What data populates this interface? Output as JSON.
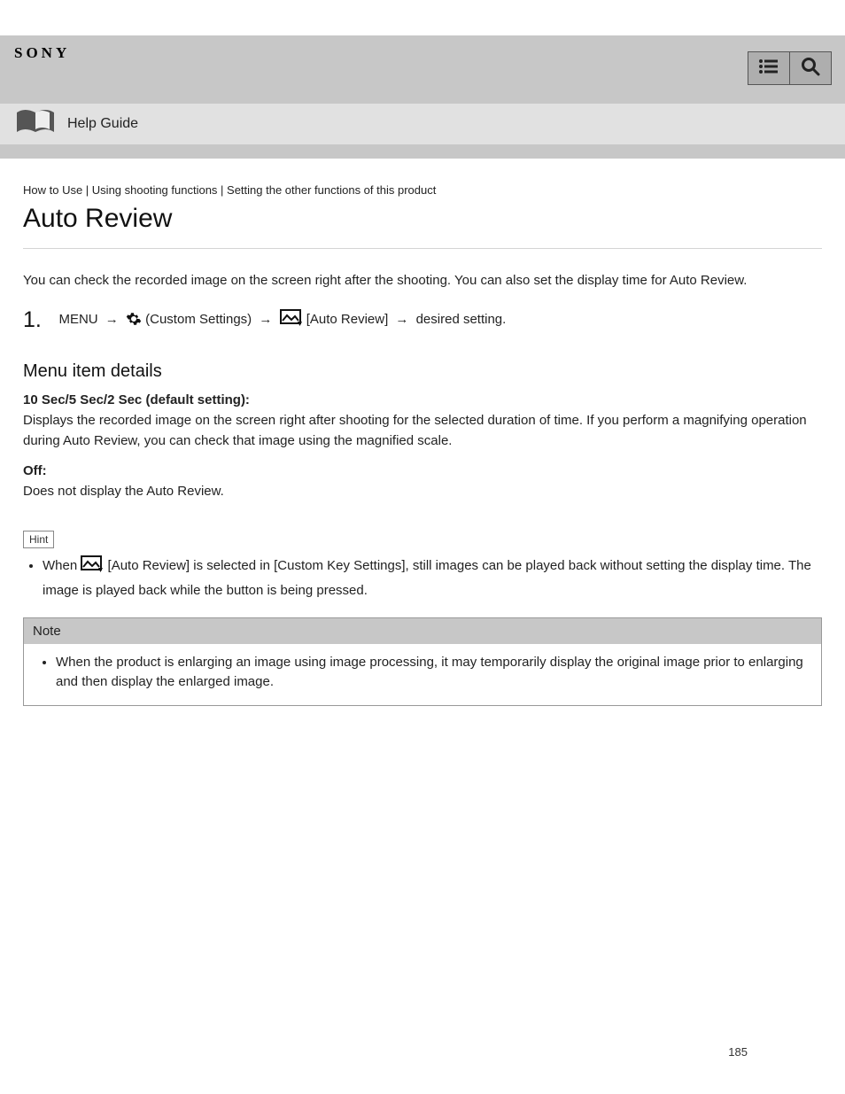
{
  "header": {
    "brand": "SONY",
    "manual_title": "Help Guide"
  },
  "breadcrumb": "How to Use | Using shooting functions | Setting the other functions of this product",
  "page_title": "Auto Review",
  "lead": "You can check the recorded image on the screen right after the shooting. You can also set the display time for Auto Review.",
  "step": {
    "number": "1.",
    "pre": "MENU",
    "arrow": "→",
    "custom_settings": "(Custom Settings)",
    "mid": "[Auto Review]",
    "tail": "desired setting."
  },
  "menu_details": {
    "heading": "Menu item details",
    "item1_title": "10 Sec/5 Sec/2 Sec (default setting):",
    "item1_body": "Displays the recorded image on the screen right after shooting for the selected duration of time. If you perform a magnifying operation during Auto Review, you can check that image using the magnified scale.",
    "item2_title": "Off:",
    "item2_body": "Does not display the Auto Review."
  },
  "hint": {
    "tag": "Hint",
    "bullet_pre": "When ",
    "bullet_mid": "[Auto Review] is selected in [Custom Key Settings], still images can be played back without setting the display time. The image is played back while the button is being pressed."
  },
  "note": {
    "heading": "Note",
    "body": "When the product is enlarging an image using image processing, it may temporarily display the original image prior to enlarging and then display the enlarged image."
  },
  "page_number": "185"
}
